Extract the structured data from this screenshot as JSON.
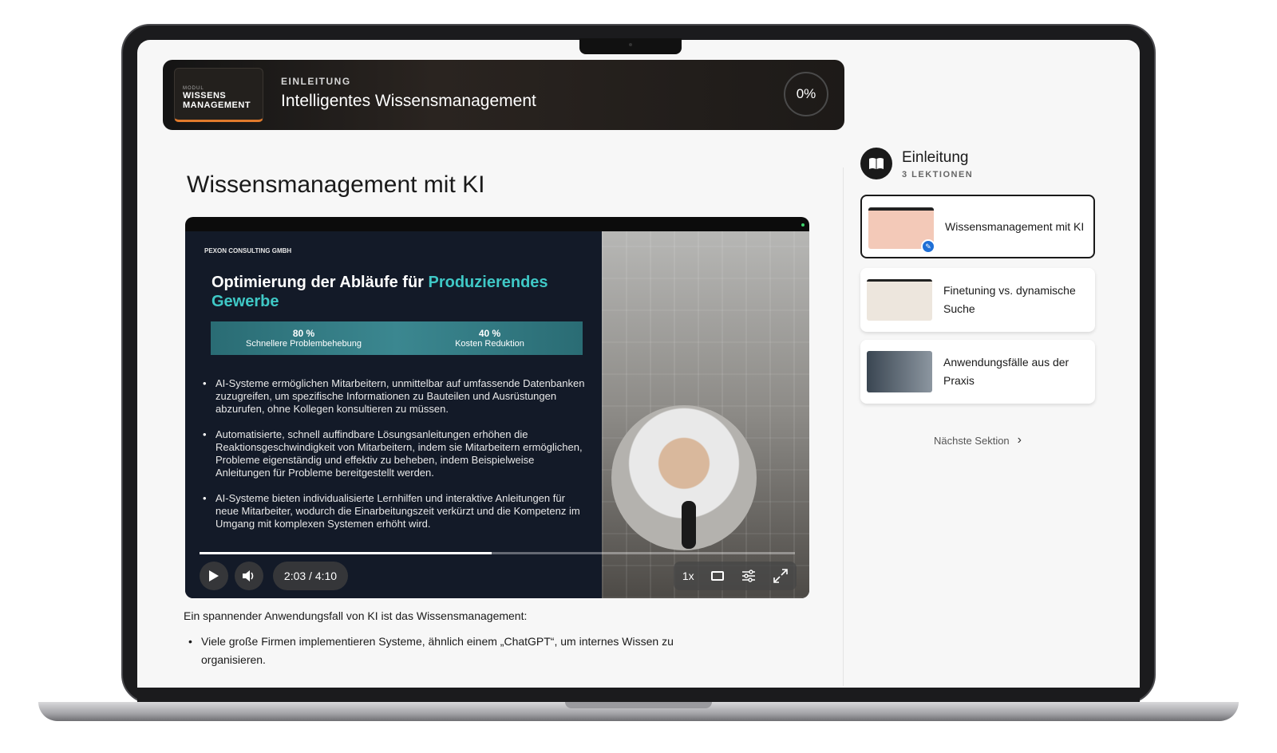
{
  "banner": {
    "logo_small": "MODUL",
    "logo_line1": "WISSENS",
    "logo_line2": "MANAGEMENT",
    "kicker": "EINLEITUNG",
    "title": "Intelligentes Wissensmanagement",
    "progress": "0%"
  },
  "lesson": {
    "title": "Wissensmanagement mit KI"
  },
  "video": {
    "slide_company": "PEXON CONSULTING GMBH",
    "slide_title_plain": "Optimierung der Abläufe für ",
    "slide_title_highlight": "Produzierendes Gewerbe",
    "stats": [
      {
        "value": "80 %",
        "label": "Schnellere Problembehebung"
      },
      {
        "value": "40 %",
        "label": "Kosten Reduktion"
      }
    ],
    "bullets": [
      "AI-Systeme ermöglichen Mitarbeitern, unmittelbar auf umfassende Datenbanken zuzugreifen, um spezifische Informationen zu Bauteilen und Ausrüstungen abzurufen, ohne Kollegen konsultieren zu müssen.",
      "Automatisierte, schnell auffindbare Lösungsanleitungen erhöhen die Reaktionsgeschwindigkeit von Mitarbeitern, indem sie Mitarbeitern ermöglichen, Probleme eigenständig und effektiv zu beheben, indem Beispielweise Anleitungen für Probleme bereitgestellt werden.",
      "AI-Systeme bieten individualisierte Lernhilfen und interaktive Anleitungen für neue Mitarbeiter, wodurch die Einarbeitungszeit verkürzt und die Kompetenz im Umgang mit komplexen Systemen erhöht wird."
    ],
    "time_display": "2:03 / 4:10",
    "playback_progress": 0.49,
    "speed": "1x",
    "icons": {
      "play": "play-icon",
      "volume": "volume-icon",
      "captions": "captions-icon",
      "settings": "settings-icon",
      "fullscreen": "fullscreen-icon"
    }
  },
  "body": {
    "intro": "Ein spannender Anwendungsfall von KI ist das Wissensmanagement:",
    "bullets": [
      "Viele große Firmen implementieren Systeme, ähnlich einem „ChatGPT“, um internes Wissen zu organisieren."
    ]
  },
  "sidebar": {
    "section_title": "Einleitung",
    "section_sub": "3 LEKTIONEN",
    "lessons": [
      {
        "label": "Wissensmanagement mit KI",
        "active": true
      },
      {
        "label": "Finetuning vs. dynamische Suche",
        "active": false
      },
      {
        "label": "Anwendungsfälle aus der Praxis",
        "active": false
      }
    ],
    "next_label": "Nächste Sektion"
  },
  "colors": {
    "accent_teal": "#3fc8c6",
    "badge_blue": "#1f6fd6",
    "logo_orange": "#e07a2c"
  }
}
